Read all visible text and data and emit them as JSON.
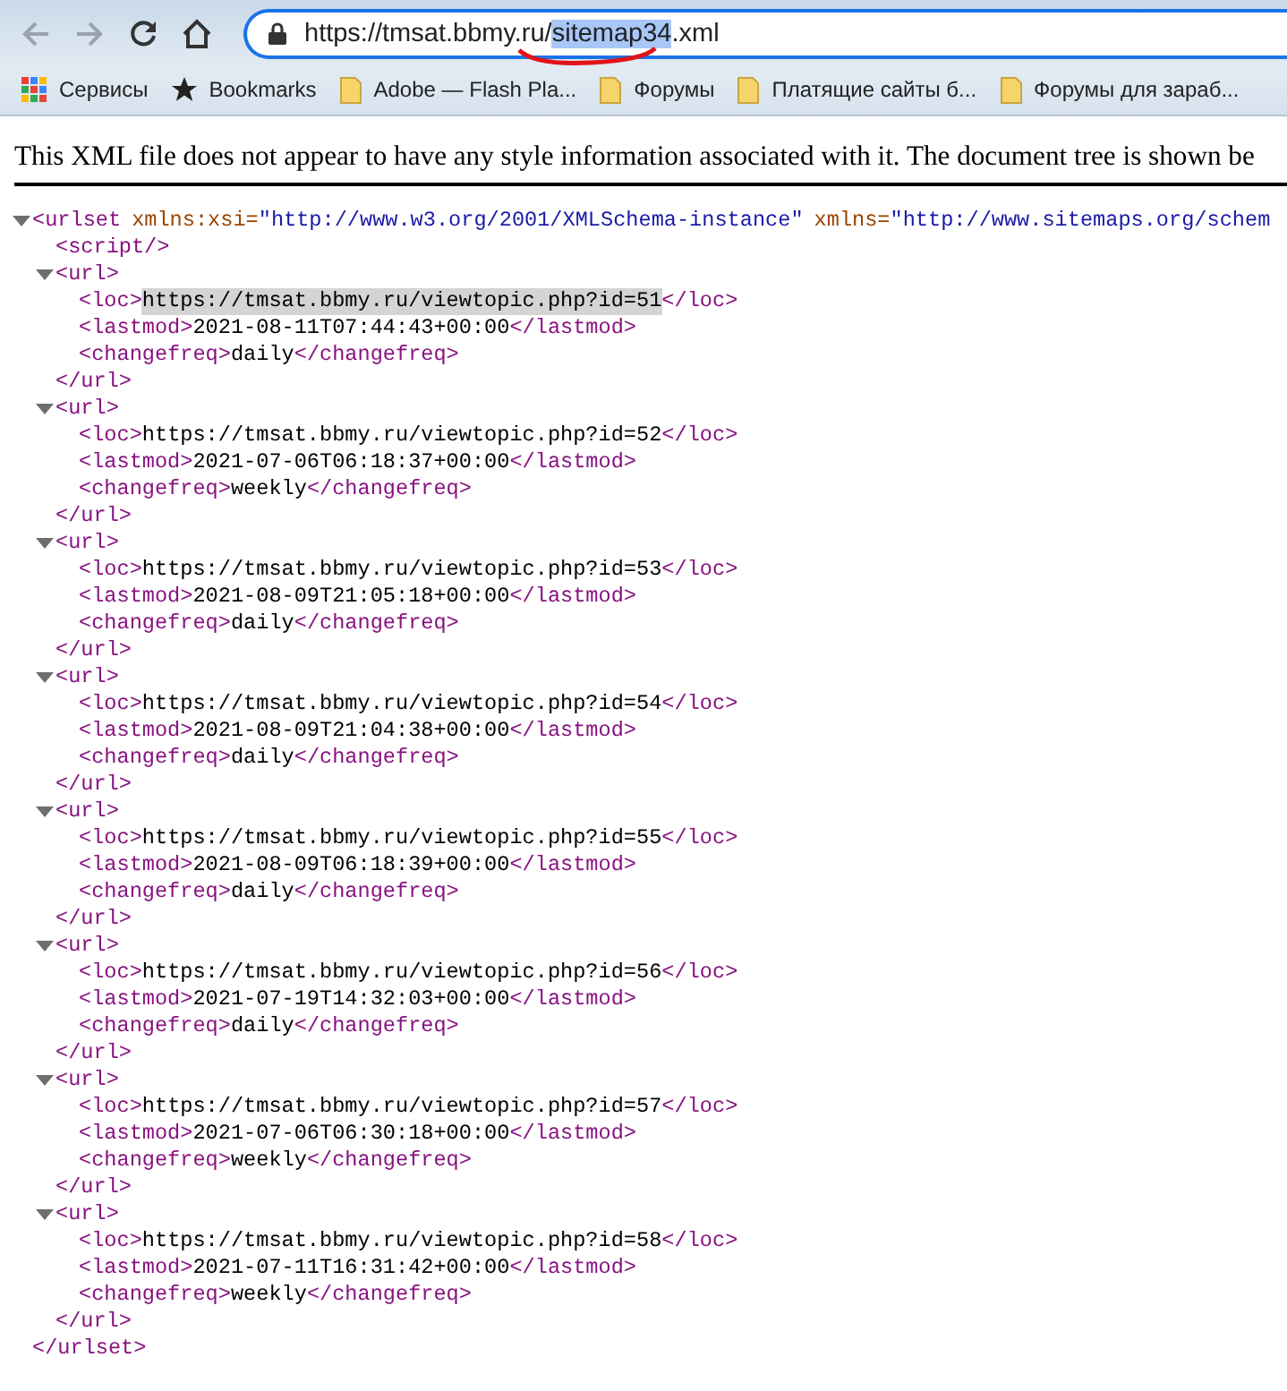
{
  "nav_buttons": [
    {
      "kind": "back",
      "disabled": true
    },
    {
      "kind": "forward",
      "disabled": true
    },
    {
      "kind": "reload",
      "disabled": false
    },
    {
      "kind": "home",
      "disabled": false
    }
  ],
  "address_bar": {
    "segments": [
      {
        "text": "https://tmsat.bbmy.ru/",
        "selected": false
      },
      {
        "text": "sitemap34",
        "selected": true
      },
      {
        "text": ".xml",
        "selected": false
      }
    ]
  },
  "bookmarks": [
    {
      "kind": "apps",
      "label": "Сервисы"
    },
    {
      "kind": "star",
      "label": "Bookmarks"
    },
    {
      "kind": "folder",
      "label": "Adobe — Flash Pla..."
    },
    {
      "kind": "folder",
      "label": "Форумы"
    },
    {
      "kind": "folder",
      "label": "Платящие сайты б..."
    },
    {
      "kind": "folder",
      "label": "Форумы для зараб..."
    }
  ],
  "notice": "This XML file does not appear to have any style information associated with it. The document tree is shown be",
  "xml_tree": {
    "kind": "element",
    "open": "<urlset",
    "attributes": [
      {
        "name": "xmlns:xsi=",
        "value": "\"http://www.w3.org/2001/XMLSchema-instance\""
      },
      {
        "name": "xmlns=",
        "value": "\"http://www.sitemaps.org/schem"
      }
    ],
    "expanded": true,
    "close": "</urlset>",
    "children": [
      {
        "kind": "empty",
        "tag": "<script/>"
      },
      {
        "kind": "element",
        "open": "<url>",
        "close": "</url>",
        "expanded": true,
        "children": [
          {
            "kind": "text",
            "open": "<loc>",
            "text": "https://tmsat.bbmy.ru/viewtopic.php?id=51",
            "close": "</loc>",
            "selected": true
          },
          {
            "kind": "text",
            "open": "<lastmod>",
            "text": "2021-08-11T07:44:43+00:00",
            "close": "</lastmod>",
            "selected": false
          },
          {
            "kind": "text",
            "open": "<changefreq>",
            "text": "daily",
            "close": "</changefreq>",
            "selected": false
          }
        ]
      },
      {
        "kind": "element",
        "open": "<url>",
        "close": "</url>",
        "expanded": true,
        "children": [
          {
            "kind": "text",
            "open": "<loc>",
            "text": "https://tmsat.bbmy.ru/viewtopic.php?id=52",
            "close": "</loc>",
            "selected": false
          },
          {
            "kind": "text",
            "open": "<lastmod>",
            "text": "2021-07-06T06:18:37+00:00",
            "close": "</lastmod>",
            "selected": false
          },
          {
            "kind": "text",
            "open": "<changefreq>",
            "text": "weekly",
            "close": "</changefreq>",
            "selected": false
          }
        ]
      },
      {
        "kind": "element",
        "open": "<url>",
        "close": "</url>",
        "expanded": true,
        "children": [
          {
            "kind": "text",
            "open": "<loc>",
            "text": "https://tmsat.bbmy.ru/viewtopic.php?id=53",
            "close": "</loc>",
            "selected": false
          },
          {
            "kind": "text",
            "open": "<lastmod>",
            "text": "2021-08-09T21:05:18+00:00",
            "close": "</lastmod>",
            "selected": false
          },
          {
            "kind": "text",
            "open": "<changefreq>",
            "text": "daily",
            "close": "</changefreq>",
            "selected": false
          }
        ]
      },
      {
        "kind": "element",
        "open": "<url>",
        "close": "</url>",
        "expanded": true,
        "children": [
          {
            "kind": "text",
            "open": "<loc>",
            "text": "https://tmsat.bbmy.ru/viewtopic.php?id=54",
            "close": "</loc>",
            "selected": false
          },
          {
            "kind": "text",
            "open": "<lastmod>",
            "text": "2021-08-09T21:04:38+00:00",
            "close": "</lastmod>",
            "selected": false
          },
          {
            "kind": "text",
            "open": "<changefreq>",
            "text": "daily",
            "close": "</changefreq>",
            "selected": false
          }
        ]
      },
      {
        "kind": "element",
        "open": "<url>",
        "close": "</url>",
        "expanded": true,
        "children": [
          {
            "kind": "text",
            "open": "<loc>",
            "text": "https://tmsat.bbmy.ru/viewtopic.php?id=55",
            "close": "</loc>",
            "selected": false
          },
          {
            "kind": "text",
            "open": "<lastmod>",
            "text": "2021-08-09T06:18:39+00:00",
            "close": "</lastmod>",
            "selected": false
          },
          {
            "kind": "text",
            "open": "<changefreq>",
            "text": "daily",
            "close": "</changefreq>",
            "selected": false
          }
        ]
      },
      {
        "kind": "element",
        "open": "<url>",
        "close": "</url>",
        "expanded": true,
        "children": [
          {
            "kind": "text",
            "open": "<loc>",
            "text": "https://tmsat.bbmy.ru/viewtopic.php?id=56",
            "close": "</loc>",
            "selected": false
          },
          {
            "kind": "text",
            "open": "<lastmod>",
            "text": "2021-07-19T14:32:03+00:00",
            "close": "</lastmod>",
            "selected": false
          },
          {
            "kind": "text",
            "open": "<changefreq>",
            "text": "daily",
            "close": "</changefreq>",
            "selected": false
          }
        ]
      },
      {
        "kind": "element",
        "open": "<url>",
        "close": "</url>",
        "expanded": true,
        "children": [
          {
            "kind": "text",
            "open": "<loc>",
            "text": "https://tmsat.bbmy.ru/viewtopic.php?id=57",
            "close": "</loc>",
            "selected": false
          },
          {
            "kind": "text",
            "open": "<lastmod>",
            "text": "2021-07-06T06:30:18+00:00",
            "close": "</lastmod>",
            "selected": false
          },
          {
            "kind": "text",
            "open": "<changefreq>",
            "text": "weekly",
            "close": "</changefreq>",
            "selected": false
          }
        ]
      },
      {
        "kind": "element",
        "open": "<url>",
        "close": "</url>",
        "expanded": true,
        "children": [
          {
            "kind": "text",
            "open": "<loc>",
            "text": "https://tmsat.bbmy.ru/viewtopic.php?id=58",
            "close": "</loc>",
            "selected": false
          },
          {
            "kind": "text",
            "open": "<lastmod>",
            "text": "2021-07-11T16:31:42+00:00",
            "close": "</lastmod>",
            "selected": false
          },
          {
            "kind": "text",
            "open": "<changefreq>",
            "text": "weekly",
            "close": "</changefreq>",
            "selected": false
          }
        ]
      }
    ]
  }
}
